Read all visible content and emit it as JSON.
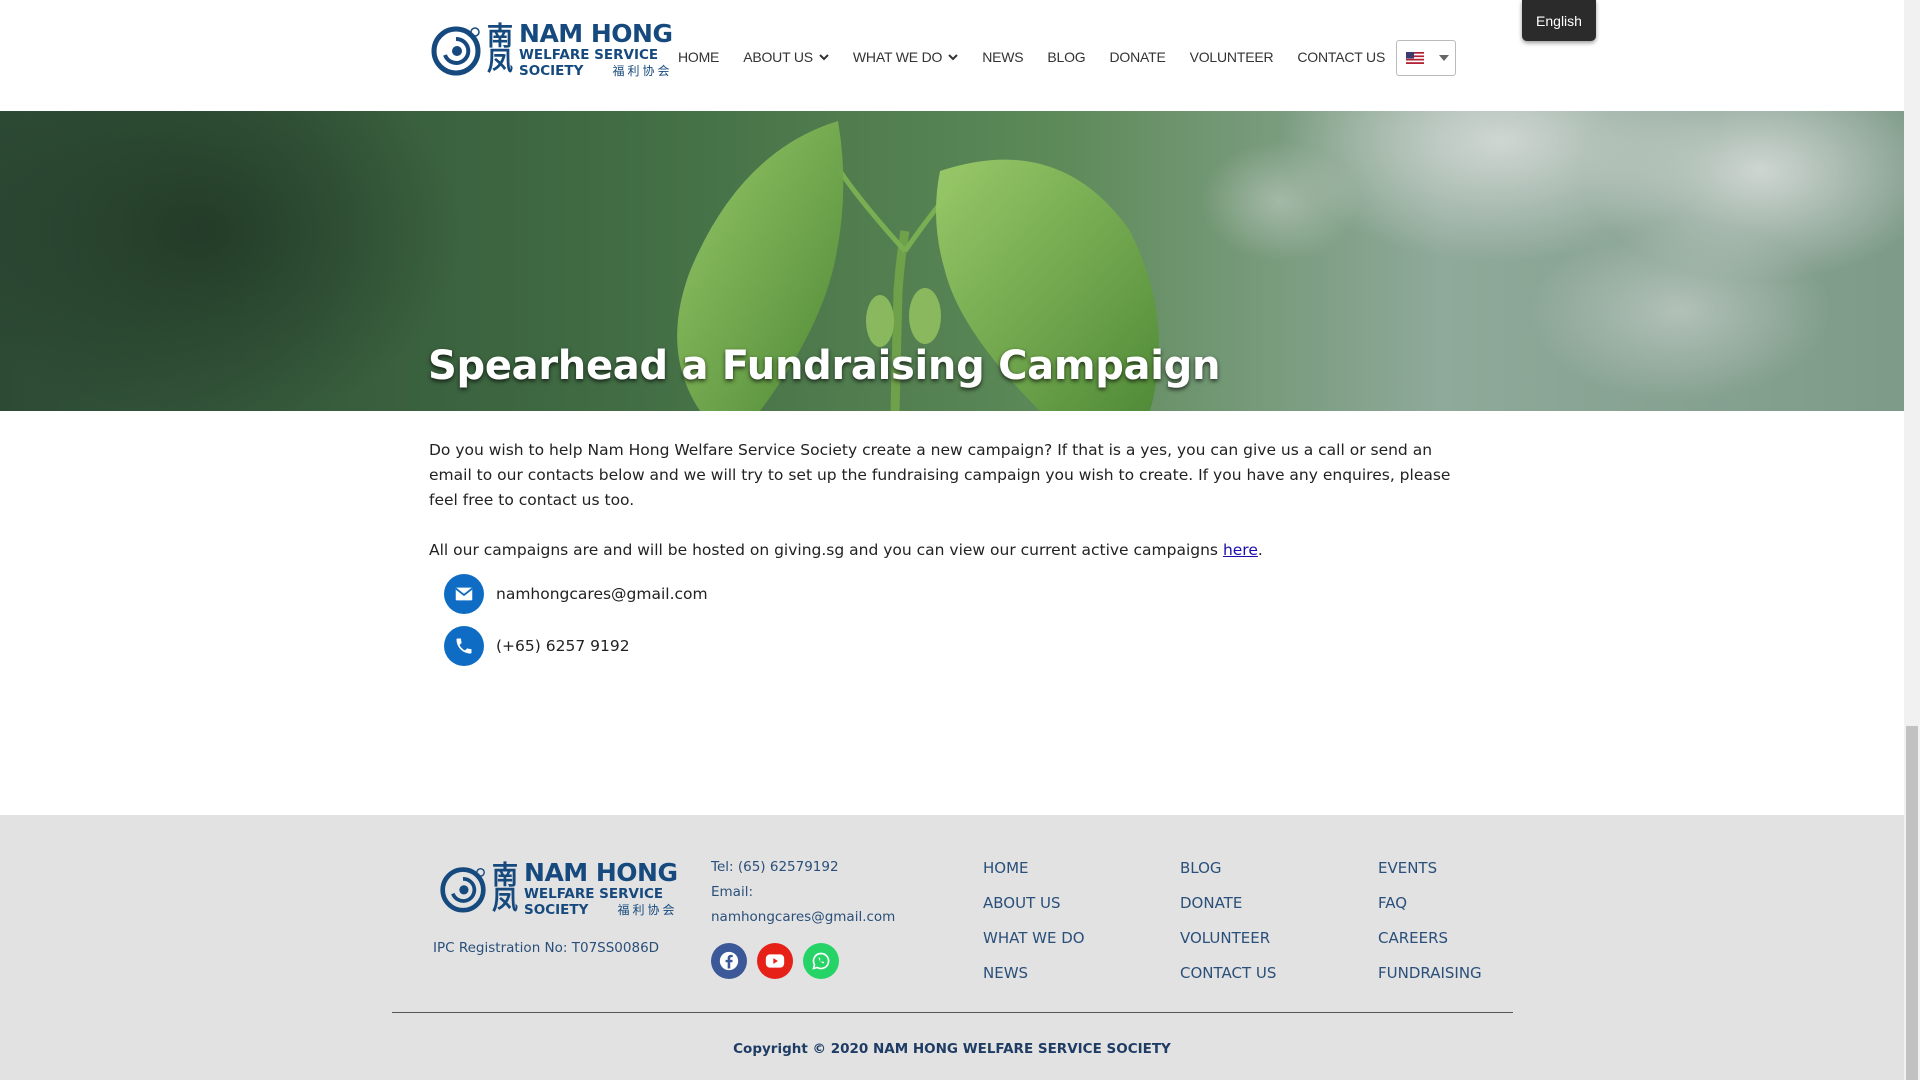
{
  "logo": {
    "cn_line1": "南",
    "cn_line2": "凤",
    "name": "NAM HONG",
    "line2": "WELFARE SERVICE",
    "line3": "SOCIETY",
    "cn_small": "福利协会"
  },
  "nav": {
    "items": [
      {
        "label": "HOME"
      },
      {
        "label": "ABOUT US",
        "has_dropdown": true
      },
      {
        "label": "WHAT WE DO",
        "has_dropdown": true
      },
      {
        "label": "NEWS"
      },
      {
        "label": "BLOG"
      },
      {
        "label": "DONATE"
      },
      {
        "label": "VOLUNTEER"
      },
      {
        "label": "CONTACT US"
      }
    ]
  },
  "language": {
    "tooltip": "English",
    "flag_icon": "us-flag-icon"
  },
  "hero": {
    "title": "Spearhead a Fundraising Campaign"
  },
  "content": {
    "paragraph1": "Do you wish to help Nam Hong Welfare Service Society create a new campaign? If that is a yes, you can give us a call or send an email to our contacts below and we will try to set up the fundraising campaign you wish to create. If you have any enquires, please feel free to contact us too.",
    "paragraph2_text": "All our campaigns are and will be hosted on giving.sg and you can view our current active campaigns ",
    "paragraph2_link": "here",
    "paragraph2_end": ".",
    "email": "namhongcares@gmail.com",
    "phone": "(+65) 6257 9192"
  },
  "footer": {
    "ipc": "IPC Registration No: T07SS0086D",
    "tel": "Tel: (65) 62579192",
    "email_label": "Email:",
    "email": "namhongcares@gmail.com",
    "socials": [
      {
        "icon": "facebook-icon",
        "color": "#3b5998"
      },
      {
        "icon": "youtube-icon",
        "color": "#e62117"
      },
      {
        "icon": "whatsapp-icon",
        "color": "#25d366"
      }
    ],
    "col1": [
      "HOME",
      "ABOUT US",
      "WHAT WE DO",
      "NEWS"
    ],
    "col2": [
      "BLOG",
      "DONATE",
      "VOLUNTEER",
      "CONTACT US"
    ],
    "col3": [
      "EVENTS",
      "FAQ",
      "CAREERS",
      "FUNDRAISING"
    ],
    "copyright": "Copyright © 2020 NAM HONG WELFARE SERVICE SOCIETY"
  },
  "colors": {
    "brand_blue": "#16497e",
    "accent_blue": "#0f6cc4",
    "footer_bg": "#e2e2e2"
  }
}
